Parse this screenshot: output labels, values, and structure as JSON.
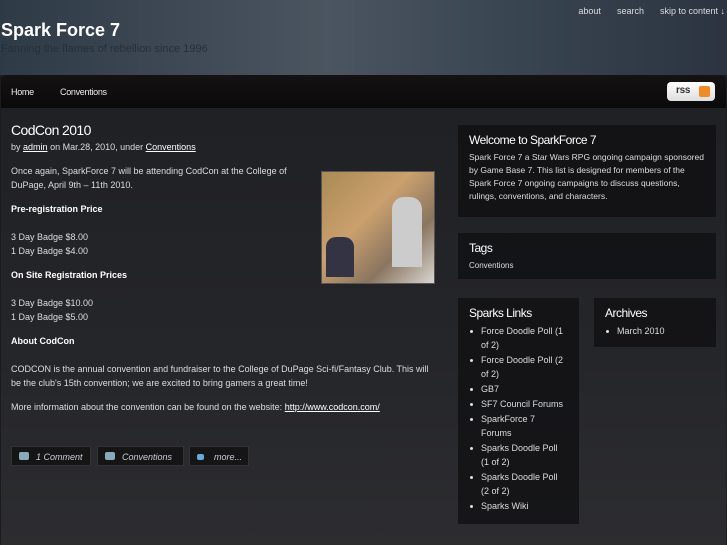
{
  "header": {
    "top_links": [
      "about",
      "search",
      "skip to content ↓"
    ],
    "site_title": "Spark Force 7",
    "tagline": "Fanning the flames of rebellion since 1996"
  },
  "nav": {
    "items": [
      "Home",
      "Conventions"
    ],
    "rss_label": "rss"
  },
  "post": {
    "title": "CodCon 2010",
    "meta_by": "by",
    "author": "admin",
    "meta_date": "on Mar.28, 2010, under",
    "category": "Conventions",
    "intro": "Once again, SparkForce 7 will be attending CodCon at the College of DuPage, April 9th – 11th 2010.",
    "pre_heading": "Pre-registration Price",
    "pre_3day": "3 Day Badge $8.00",
    "pre_1day": "1 Day Badge $4.00",
    "onsite_heading": "On Site Registration Prices",
    "onsite_3day": "3 Day Badge $10.00",
    "onsite_1day": "1 Day Badge $5.00",
    "about_heading": "About CodCon",
    "about_text": "CODCON is the annual convention and fundraiser to the College of DuPage Sci-fi/Fantasy Club. This will be the club's 15th convention; we are excited to bring gamers a great time!",
    "more_info": "More information about the convention can be found on the website:",
    "website": "http://www.codcon.com/",
    "buttons": {
      "comments": "1 Comment",
      "category": "Conventions",
      "more": "more..."
    }
  },
  "sidebar": {
    "welcome": {
      "title": "Welcome to SparkForce 7",
      "text": "Spark Force 7 a Star Wars RPG ongoing campaign sponsored by Game Base 7. This list is designed for members of the Spark Force 7 ongoing campaigns to discuss questions, rulings, conventions, and characters."
    },
    "tags": {
      "title": "Tags",
      "items": [
        "Conventions"
      ]
    },
    "links": {
      "title": "Sparks Links",
      "items": [
        "Force Doodle Poll (1 of 2)",
        "Force Doodle Poll (2 of 2)",
        "GB7",
        "SF7 Council Forums",
        "SparkForce 7 Forums",
        "Sparks Doodle Poll (1 of 2)",
        "Sparks Doodle Poll (2 of 2)",
        "Sparks Wiki"
      ]
    },
    "archives": {
      "title": "Archives",
      "items": [
        "March 2010"
      ]
    }
  }
}
